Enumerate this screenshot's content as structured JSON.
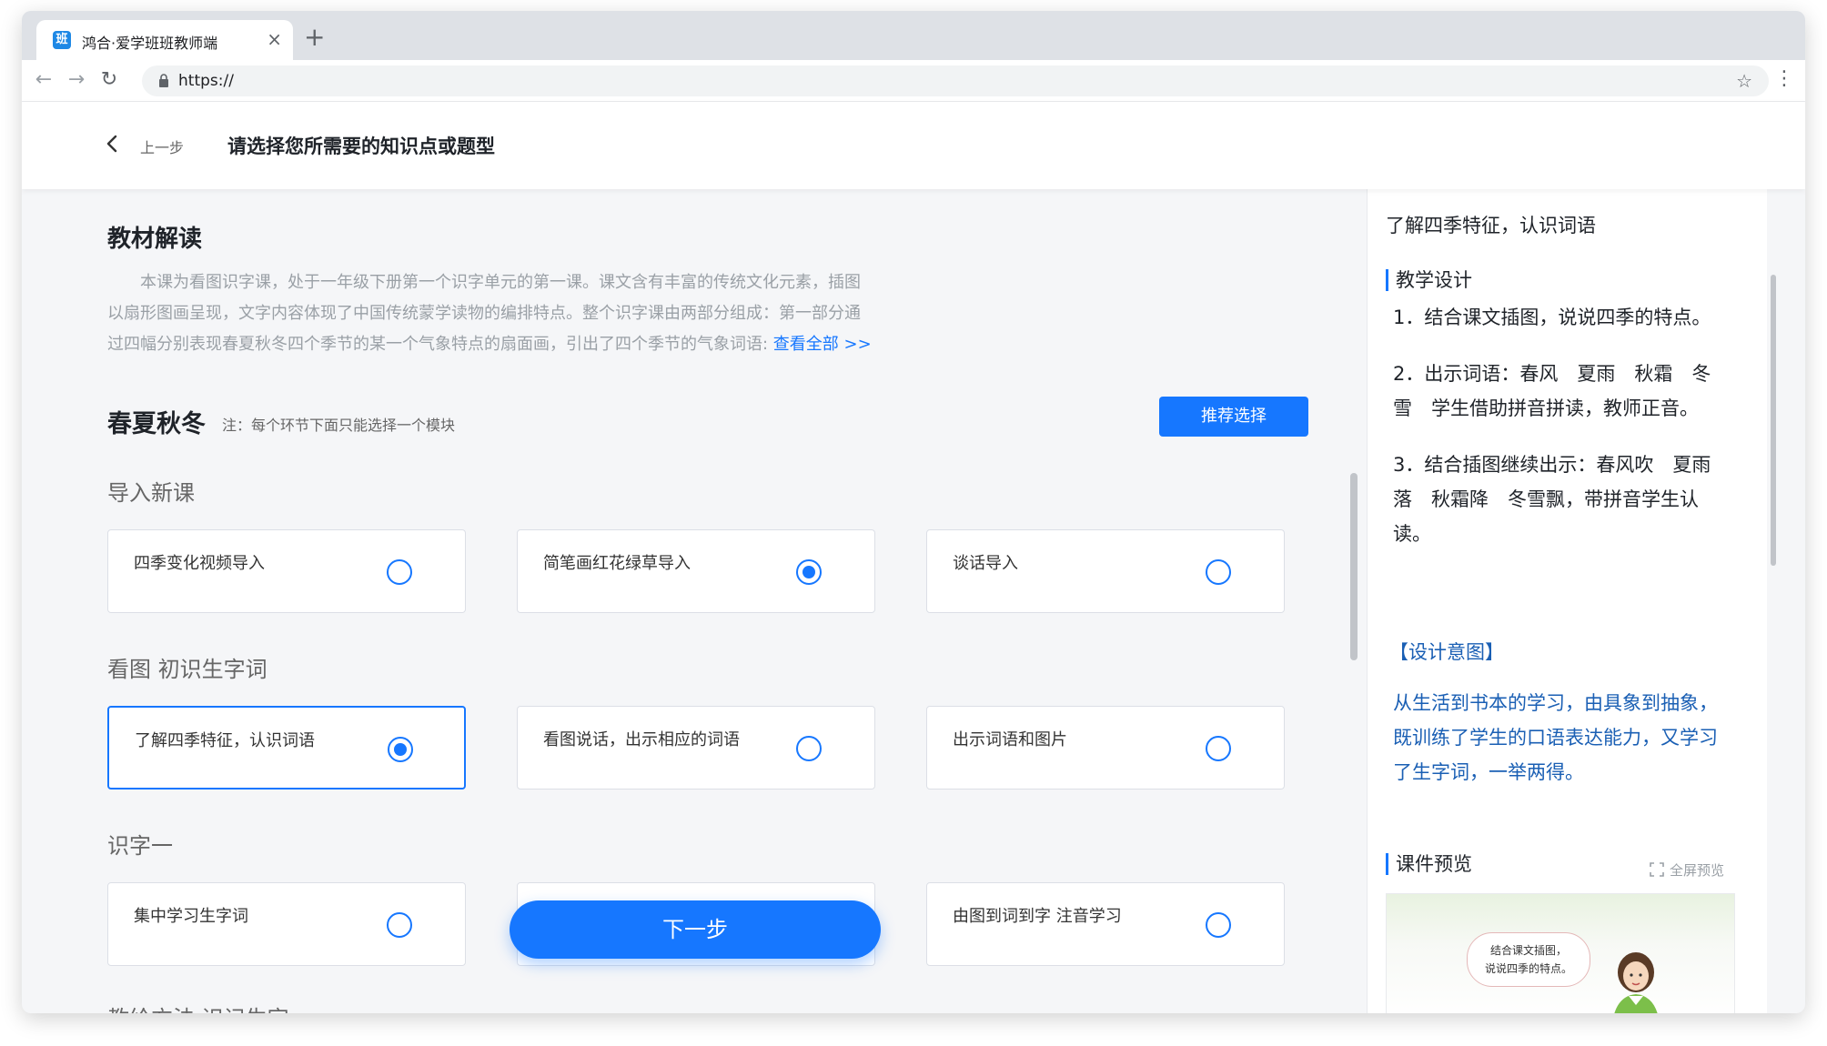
{
  "browser": {
    "tab_title": "鸿合·爱学班班教师端",
    "favicon_text": "班",
    "url": "https://"
  },
  "header": {
    "back_label": "上一步",
    "title": "请选择您所需要的知识点或题型"
  },
  "textbook": {
    "heading": "教材解读",
    "lines": [
      "　　本课为看图识字课，处于一年级下册第一个识字单元的第一课。课文含有丰富的传统文化元素，插图",
      "以扇形图画呈现，文字内容体现了中国传统蒙学读物的编排特点。整个识字课由两部分组成：第一部分通",
      "过四幅分别表现春夏秋冬四个季节的某一个气象特点的扇面画，引出了四个季节的气象词语"
    ],
    "view_all": "查看全部 >>"
  },
  "lesson": {
    "title": "春夏秋冬",
    "note": "注：每个环节下面只能选择一个模块",
    "recommend_label": "推荐选择"
  },
  "groups": [
    {
      "label": "导入新课",
      "options": [
        {
          "label": "四季变化视频导入",
          "selected": false
        },
        {
          "label": "简笔画红花绿草导入",
          "selected": true
        },
        {
          "label": "谈话导入",
          "selected": false
        }
      ]
    },
    {
      "label": "看图 初识生字词",
      "options": [
        {
          "label": "了解四季特征，认识词语",
          "selected": true
        },
        {
          "label": "看图说话，出示相应的词语",
          "selected": false
        },
        {
          "label": "出示词语和图片",
          "selected": false
        }
      ]
    },
    {
      "label": "识字一",
      "options": [
        {
          "label": "集中学习生字词",
          "selected": false
        },
        {
          "label": "",
          "selected": false
        },
        {
          "label": "由图到词到字 注音学习",
          "selected": false
        }
      ]
    },
    {
      "label": "教给方法 识记生字",
      "options": []
    }
  ],
  "next_label": "下一步",
  "side": {
    "title": "了解四季特征，认识词语",
    "design_heading": "教学设计",
    "steps": [
      "1．结合课文插图，说说四季的特点。",
      "2．出示词语：春风　夏雨　秋霜　冬雪　学生借助拼音拼读，教师正音。",
      "3．结合插图继续出示：春风吹　夏雨落　秋霜降　冬雪飘，带拼音学生认读。"
    ],
    "intent_heading": "【设计意图】",
    "intent_text": "从生活到书本的学习，由具象到抽象，既训练了学生的口语表达能力，又学习了生字词，一举两得。",
    "preview_heading": "课件预览",
    "fullscreen_label": "全屏预览",
    "preview_bubble": [
      "结合课文插图，",
      "说说四季的特点。"
    ]
  },
  "colors": {
    "accent": "#1677ff",
    "intent_text": "#1a5fb4",
    "page_bg": "#f5f6f8"
  }
}
